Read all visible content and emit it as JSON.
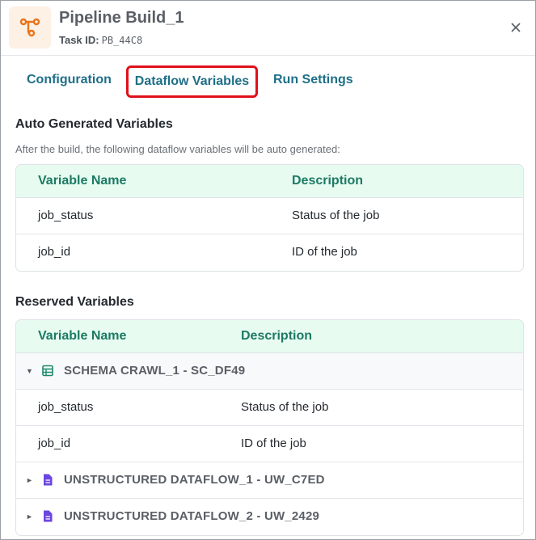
{
  "header": {
    "title": "Pipeline Build_1",
    "task_id_label": "Task ID:",
    "task_id_value": "PB_44C8",
    "icon": "pipeline-icon",
    "accent_color": "#e8731a"
  },
  "tabs": [
    {
      "label": "Configuration",
      "active": false
    },
    {
      "label": "Dataflow Variables",
      "active": true
    },
    {
      "label": "Run Settings",
      "active": false
    }
  ],
  "auto_generated": {
    "title": "Auto Generated Variables",
    "description": "After the build, the following dataflow variables will be auto generated:",
    "columns": [
      "Variable Name",
      "Description"
    ],
    "rows": [
      {
        "name": "job_status",
        "description": "Status of the job"
      },
      {
        "name": "job_id",
        "description": "ID of the job"
      }
    ]
  },
  "reserved": {
    "title": "Reserved Variables",
    "columns": [
      "Variable Name",
      "Description"
    ],
    "groups": [
      {
        "label": "SCHEMA CRAWL_1 - SC_DF49",
        "expanded": true,
        "icon": "table-icon",
        "rows": [
          {
            "name": "job_status",
            "description": "Status of the job"
          },
          {
            "name": "job_id",
            "description": "ID of the job"
          }
        ]
      },
      {
        "label": "UNSTRUCTURED DATAFLOW_1 - UW_C7ED",
        "expanded": false,
        "icon": "document-icon"
      },
      {
        "label": "UNSTRUCTURED DATAFLOW_2 - UW_2429",
        "expanded": false,
        "icon": "document-icon"
      }
    ]
  },
  "colors": {
    "tab_text": "#1e6f87",
    "highlight_border": "#e0111a",
    "header_row_bg": "#e7fbf0",
    "header_row_text": "#1c7a64",
    "schema_icon": "#1c8a6a",
    "document_icon": "#6b46e0"
  }
}
